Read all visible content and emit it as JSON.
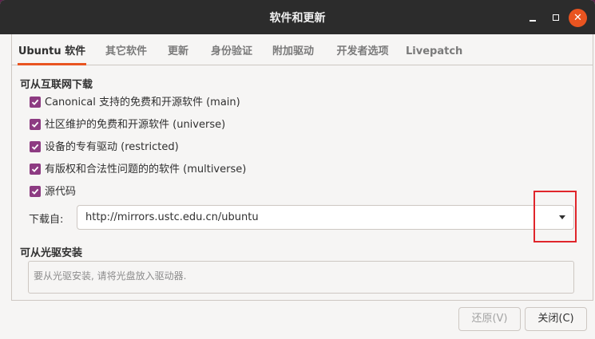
{
  "window": {
    "title": "软件和更新"
  },
  "tabs": [
    {
      "label": "Ubuntu 软件",
      "active": true
    },
    {
      "label": "其它软件",
      "active": false
    },
    {
      "label": "更新",
      "active": false
    },
    {
      "label": "身份验证",
      "active": false
    },
    {
      "label": "附加驱动",
      "active": false
    },
    {
      "label": "开发者选项",
      "active": false
    },
    {
      "label": "Livepatch",
      "active": false
    }
  ],
  "internet": {
    "heading": "可从互联网下载",
    "sources": [
      {
        "label": "Canonical 支持的免费和开源软件 (main)",
        "checked": true
      },
      {
        "label": "社区维护的免费和开源软件 (universe)",
        "checked": true
      },
      {
        "label": "设备的专有驱动 (restricted)",
        "checked": true
      },
      {
        "label": "有版权和合法性问题的的软件 (multiverse)",
        "checked": true
      },
      {
        "label": "源代码",
        "checked": true
      }
    ],
    "download_from_label": "下载自:",
    "download_from_value": "http://mirrors.ustc.edu.cn/ubuntu"
  },
  "cdrom": {
    "heading": "可从光驱安装",
    "placeholder": "要从光驱安装, 请将光盘放入驱动器."
  },
  "buttons": {
    "revert": "还原(V)",
    "close": "关闭(C)"
  },
  "colors": {
    "accent": "#e95420",
    "checkbox": "#8d3b82",
    "highlight_box": "#e0252b"
  }
}
